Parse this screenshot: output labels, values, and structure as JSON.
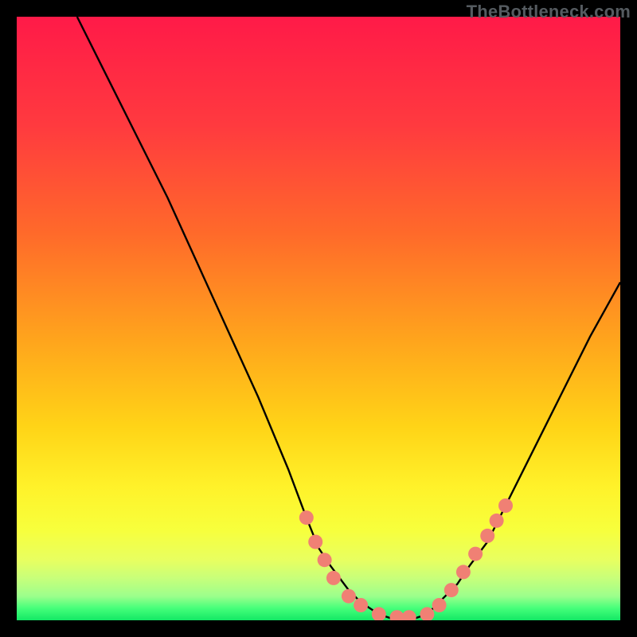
{
  "watermark": {
    "text": "TheBottleneck.com"
  },
  "chart_data": {
    "type": "line",
    "title": "",
    "xlabel": "",
    "ylabel": "",
    "ylim": [
      0,
      100
    ],
    "xlim": [
      0,
      100
    ],
    "series": [
      {
        "name": "curve",
        "x": [
          10,
          15,
          20,
          25,
          30,
          35,
          40,
          45,
          48,
          50,
          52,
          55,
          57,
          60,
          63,
          65,
          68,
          70,
          73,
          75,
          78,
          80,
          85,
          90,
          95,
          100
        ],
        "y": [
          100,
          90,
          80,
          70,
          59,
          48,
          37,
          25,
          17,
          12,
          9,
          5,
          3,
          1,
          0,
          0,
          1,
          3,
          6,
          9,
          13,
          17,
          27,
          37,
          47,
          56
        ]
      }
    ],
    "markers": {
      "name": "dots",
      "x": [
        48,
        49.5,
        51,
        52.5,
        55,
        57,
        60,
        63,
        65,
        68,
        70,
        72,
        74,
        76,
        78,
        79.5,
        81
      ],
      "y": [
        17,
        13,
        10,
        7,
        4,
        2.5,
        1,
        0.5,
        0.5,
        1,
        2.5,
        5,
        8,
        11,
        14,
        16.5,
        19
      ]
    },
    "colors": {
      "curve": "#000000",
      "markers": "#f08074",
      "gradient_top": "#ff1a48",
      "gradient_bottom": "#13e865",
      "background": "#000000"
    }
  }
}
